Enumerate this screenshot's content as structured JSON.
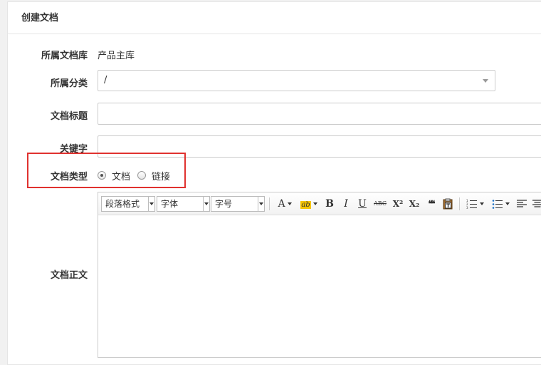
{
  "panel": {
    "title": "创建文档"
  },
  "form": {
    "library": {
      "label": "所属文档库",
      "value": "产品主库"
    },
    "category": {
      "label": "所属分类",
      "value": "/"
    },
    "title": {
      "label": "文档标题",
      "value": ""
    },
    "keywords": {
      "label": "关键字",
      "value": ""
    },
    "doc_type": {
      "label": "文档类型",
      "options": [
        {
          "label": "文档",
          "checked": true
        },
        {
          "label": "链接",
          "checked": false
        }
      ]
    },
    "content": {
      "label": "文档正文"
    }
  },
  "editor": {
    "combos": {
      "paragraph": "段落格式",
      "font": "字体",
      "size": "字号"
    },
    "buttons": {
      "font_color": "A",
      "highlight": "ab",
      "bold": "B",
      "italic": "I",
      "underline": "U",
      "strike": "ABC",
      "superscript": "X²",
      "subscript": "X₂",
      "quote": "❝❝"
    }
  },
  "colors": {
    "highlight_border": "#e0322f"
  }
}
